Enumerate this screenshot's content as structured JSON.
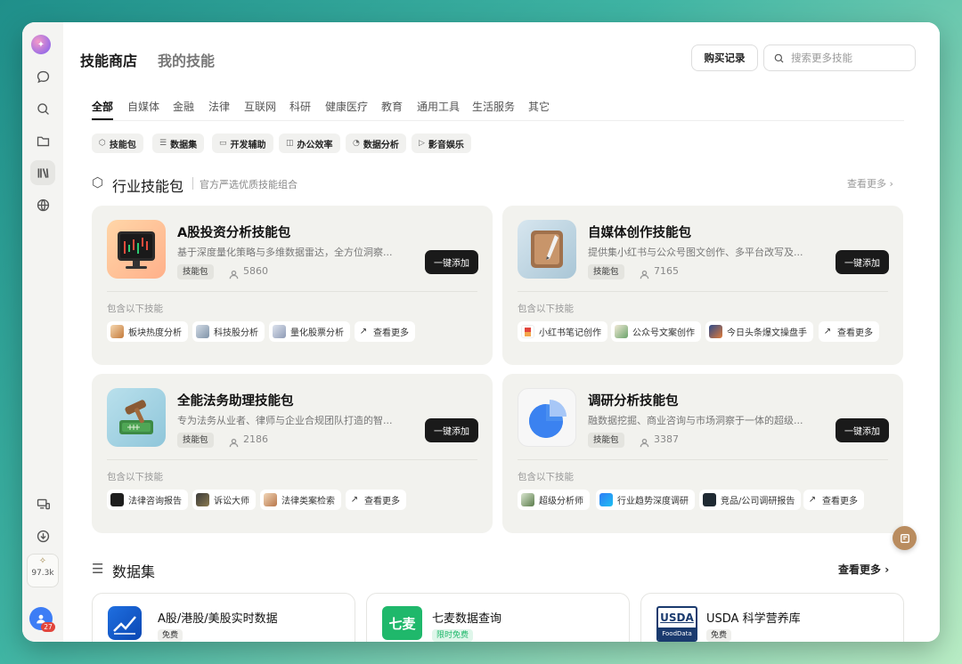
{
  "sidebar": {
    "usage": "97.3k",
    "notifications": "27",
    "icons": [
      "logo-icon",
      "chat-icon",
      "search-icon",
      "folder-icon",
      "library-icon",
      "globe-icon",
      "devices-icon",
      "download-icon",
      "sparkle-icon",
      "user-icon"
    ]
  },
  "header": {
    "tab_store": "技能商店",
    "tab_mine": "我的技能",
    "purchase_label": "购买记录",
    "search_placeholder": "搜索更多技能"
  },
  "categories": [
    "全部",
    "自媒体",
    "金融",
    "法律",
    "互联网",
    "科研",
    "健康医疗",
    "教育",
    "通用工具",
    "生活服务",
    "其它"
  ],
  "filters": [
    "技能包",
    "数据集",
    "开发辅助",
    "办公效率",
    "数据分析",
    "影音娱乐"
  ],
  "industry": {
    "title": "行业技能包",
    "subtitle": "官方严选优质技能组合",
    "more": "查看更多",
    "includes_label": "包含以下技能",
    "add_label": "一键添加",
    "tag": "技能包",
    "packs": [
      {
        "title": "A股投资分析技能包",
        "desc": "基于深度量化策略与多维数据雷达，全方位洞察...",
        "count": "5860",
        "skills": [
          "板块热度分析",
          "科技股分析",
          "量化股票分析"
        ],
        "more": "查看更多"
      },
      {
        "title": "自媒体创作技能包",
        "desc": "提供集小红书与公众号图文创作、多平台改写及...",
        "count": "7165",
        "skills": [
          "小红书笔记创作",
          "公众号文案创作",
          "今日头条爆文操盘手"
        ],
        "more": "查看更多"
      },
      {
        "title": "全能法务助理技能包",
        "desc": "专为法务从业者、律师与企业合规团队打造的智...",
        "count": "2186",
        "skills": [
          "法律咨询报告",
          "诉讼大师",
          "法律类案检索"
        ],
        "more": "查看更多"
      },
      {
        "title": "调研分析技能包",
        "desc": "融数据挖掘、商业咨询与市场洞察于一体的超级...",
        "count": "3387",
        "skills": [
          "超级分析师",
          "行业趋势深度调研",
          "竞品/公司调研报告"
        ],
        "more": "查看更多"
      }
    ]
  },
  "datasets": {
    "title": "数据集",
    "more": "查看更多",
    "items": [
      {
        "title": "A股/港股/美股实时数据",
        "tag": "免费"
      },
      {
        "title": "七麦数据查询",
        "tag": "限时免费",
        "logo": "七麦"
      },
      {
        "title": "USDA 科学营养库",
        "tag": "免费",
        "logo": "USDA",
        "logo_sub": "FoodData"
      }
    ]
  },
  "colors": {
    "accent": "#1a1a1a",
    "card_bg": "#f2f2ee",
    "qimai_green": "#1fb86b",
    "badge_red": "#e2453c",
    "float_button": "#b98c5f"
  }
}
